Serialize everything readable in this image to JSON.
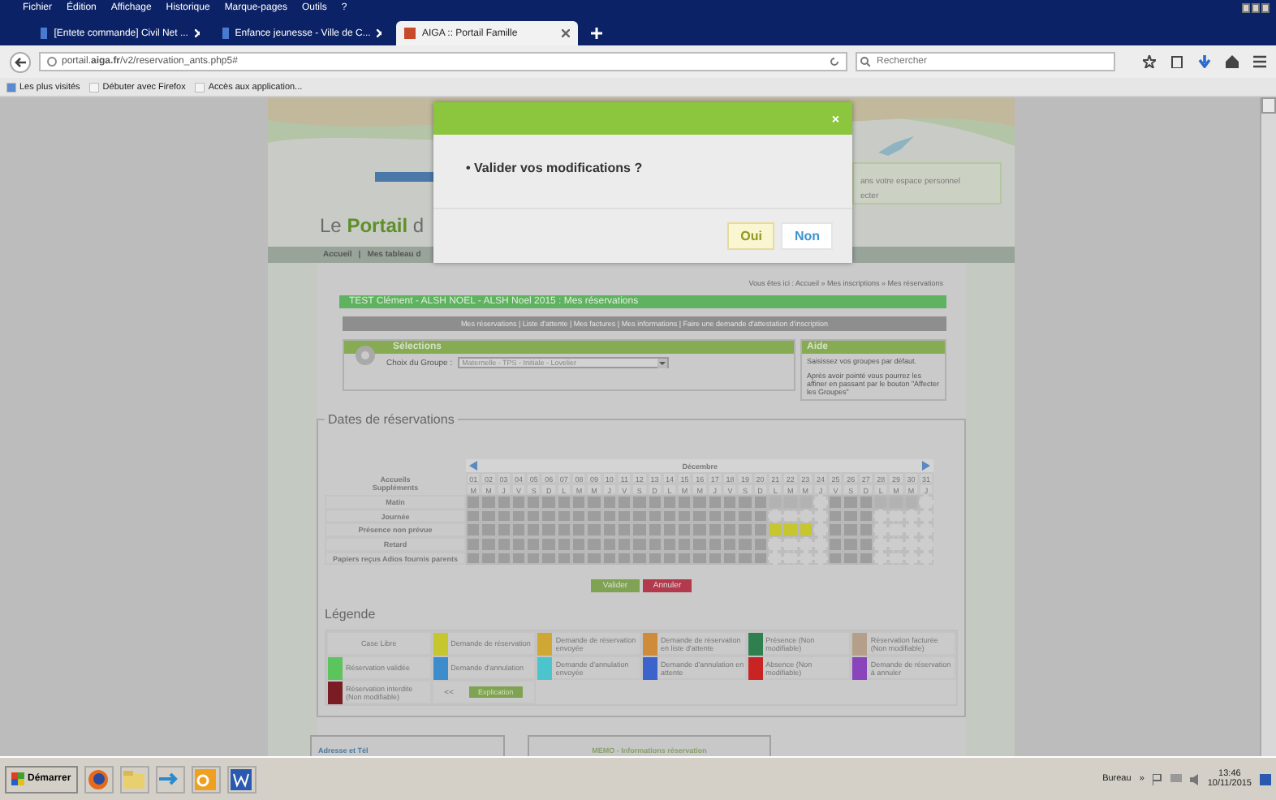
{
  "browser": {
    "menu": [
      "Fichier",
      "Édition",
      "Affichage",
      "Historique",
      "Marque-pages",
      "Outils",
      "?"
    ],
    "tabs": [
      {
        "title": "[Entete commande] Civil Net ...",
        "selected": false
      },
      {
        "title": "Enfance jeunesse - Ville de C...",
        "selected": false
      },
      {
        "title": "AIGA :: Portail Famille",
        "selected": true
      }
    ],
    "address": "portail.**aiga.fr**/v2/reservation_ants.php5#",
    "search": {
      "placeholder": "Rechercher"
    },
    "bookmarks": [
      "Les plus visités",
      "Débuter avec Firefox",
      "Accès aux application..."
    ]
  },
  "page": {
    "header": {
      "logo": "Le **Portail** d",
      "account_lines": [
        "ans votre espace personnel",
        "ecter"
      ]
    },
    "nav": [
      "Accueil",
      "|",
      "Mes tableau d"
    ],
    "breadcrumb": "Vous êtes ici : Accueil » Mes inscriptions » Mes réservations",
    "title": "TEST Clément - ALSH NOEL - ALSH Noel 2015 : Mes réservations",
    "subnav": "Mes réservations | Liste d'attente | Mes factures | Mes informations | Faire une demande d'attestation d'inscription",
    "selections": {
      "title": "Sélections",
      "group_label": "Choix du Groupe :",
      "group_value": "Maternelle - TPS - Initiale - Lovelier"
    },
    "help": {
      "title": "Aide",
      "paragraphs": [
        "Saisissez vos groupes par défaut.",
        "Après avoir pointé vous pourrez les affiner en passant par le bouton \"Affecter les Groupes\""
      ]
    },
    "reservations": {
      "legend": "Dates de réservations",
      "month": "Décembre",
      "header_labels": [
        "Accueils",
        "Suppléments"
      ],
      "days": [
        {
          "num": "01",
          "letter": "M"
        },
        {
          "num": "02",
          "letter": "M"
        },
        {
          "num": "03",
          "letter": "J"
        },
        {
          "num": "04",
          "letter": "V"
        },
        {
          "num": "05",
          "letter": "S"
        },
        {
          "num": "06",
          "letter": "D"
        },
        {
          "num": "07",
          "letter": "L"
        },
        {
          "num": "08",
          "letter": "M"
        },
        {
          "num": "09",
          "letter": "M"
        },
        {
          "num": "10",
          "letter": "J"
        },
        {
          "num": "11",
          "letter": "V"
        },
        {
          "num": "12",
          "letter": "S"
        },
        {
          "num": "13",
          "letter": "D"
        },
        {
          "num": "14",
          "letter": "L"
        },
        {
          "num": "15",
          "letter": "M"
        },
        {
          "num": "16",
          "letter": "M"
        },
        {
          "num": "17",
          "letter": "J"
        },
        {
          "num": "18",
          "letter": "V"
        },
        {
          "num": "19",
          "letter": "S"
        },
        {
          "num": "20",
          "letter": "D"
        },
        {
          "num": "21",
          "letter": "L"
        },
        {
          "num": "22",
          "letter": "M"
        },
        {
          "num": "23",
          "letter": "M"
        },
        {
          "num": "24",
          "letter": "J"
        },
        {
          "num": "25",
          "letter": "V"
        },
        {
          "num": "26",
          "letter": "S"
        },
        {
          "num": "27",
          "letter": "D"
        },
        {
          "num": "28",
          "letter": "L"
        },
        {
          "num": "29",
          "letter": "M"
        },
        {
          "num": "30",
          "letter": "M"
        },
        {
          "num": "31",
          "letter": "J"
        }
      ],
      "rows": [
        {
          "label": "Matin",
          "cells": [
            {
              "kind": "closed"
            },
            {
              "kind": "closed"
            },
            {
              "kind": "closed"
            },
            {
              "kind": "closed"
            },
            {
              "kind": "closed"
            },
            {
              "kind": "closed"
            },
            {
              "kind": "closed"
            },
            {
              "kind": "closed"
            },
            {
              "kind": "closed"
            },
            {
              "kind": "closed"
            },
            {
              "kind": "closed"
            },
            {
              "kind": "closed"
            },
            {
              "kind": "closed"
            },
            {
              "kind": "closed"
            },
            {
              "kind": "closed"
            },
            {
              "kind": "closed"
            },
            {
              "kind": "closed"
            },
            {
              "kind": "closed"
            },
            {
              "kind": "closed"
            },
            {
              "kind": "closed"
            },
            {
              "kind": "unavailable"
            },
            {
              "kind": "unavailable"
            },
            {
              "kind": "unavailable"
            },
            {
              "kind": "free"
            },
            {
              "kind": "closed"
            },
            {
              "kind": "closed"
            },
            {
              "kind": "closed"
            },
            {
              "kind": "unavailable"
            },
            {
              "kind": "unavailable"
            },
            {
              "kind": "unavailable"
            },
            {
              "kind": "free"
            }
          ]
        },
        {
          "label": "Journée",
          "cells": [
            {
              "kind": "closed"
            },
            {
              "kind": "closed"
            },
            {
              "kind": "closed"
            },
            {
              "kind": "closed"
            },
            {
              "kind": "closed"
            },
            {
              "kind": "closed"
            },
            {
              "kind": "closed"
            },
            {
              "kind": "closed"
            },
            {
              "kind": "closed"
            },
            {
              "kind": "closed"
            },
            {
              "kind": "closed"
            },
            {
              "kind": "closed"
            },
            {
              "kind": "closed"
            },
            {
              "kind": "closed"
            },
            {
              "kind": "closed"
            },
            {
              "kind": "closed"
            },
            {
              "kind": "closed"
            },
            {
              "kind": "closed"
            },
            {
              "kind": "closed"
            },
            {
              "kind": "closed"
            },
            {
              "kind": "free"
            },
            {
              "kind": "free"
            },
            {
              "kind": "free"
            },
            {
              "kind": "free"
            },
            {
              "kind": "closed"
            },
            {
              "kind": "closed"
            },
            {
              "kind": "closed"
            },
            {
              "kind": "free"
            },
            {
              "kind": "free"
            },
            {
              "kind": "free"
            },
            {
              "kind": "free"
            }
          ]
        },
        {
          "label": "Présence non prévue",
          "cells": [
            {
              "kind": "closed"
            },
            {
              "kind": "closed"
            },
            {
              "kind": "closed"
            },
            {
              "kind": "closed"
            },
            {
              "kind": "closed"
            },
            {
              "kind": "closed"
            },
            {
              "kind": "closed"
            },
            {
              "kind": "closed"
            },
            {
              "kind": "closed"
            },
            {
              "kind": "closed"
            },
            {
              "kind": "closed"
            },
            {
              "kind": "closed"
            },
            {
              "kind": "closed"
            },
            {
              "kind": "closed"
            },
            {
              "kind": "closed"
            },
            {
              "kind": "closed"
            },
            {
              "kind": "closed"
            },
            {
              "kind": "closed"
            },
            {
              "kind": "closed"
            },
            {
              "kind": "closed"
            },
            {
              "kind": "requested"
            },
            {
              "kind": "requested"
            },
            {
              "kind": "requested"
            },
            {
              "kind": "free"
            },
            {
              "kind": "closed"
            },
            {
              "kind": "closed"
            },
            {
              "kind": "closed"
            },
            {
              "kind": "free"
            },
            {
              "kind": "free"
            },
            {
              "kind": "free"
            },
            {
              "kind": "free"
            }
          ]
        },
        {
          "label": "Retard",
          "cells": [
            {
              "kind": "closed"
            },
            {
              "kind": "closed"
            },
            {
              "kind": "closed"
            },
            {
              "kind": "closed"
            },
            {
              "kind": "closed"
            },
            {
              "kind": "closed"
            },
            {
              "kind": "closed"
            },
            {
              "kind": "closed"
            },
            {
              "kind": "closed"
            },
            {
              "kind": "closed"
            },
            {
              "kind": "closed"
            },
            {
              "kind": "closed"
            },
            {
              "kind": "closed"
            },
            {
              "kind": "closed"
            },
            {
              "kind": "closed"
            },
            {
              "kind": "closed"
            },
            {
              "kind": "closed"
            },
            {
              "kind": "closed"
            },
            {
              "kind": "closed"
            },
            {
              "kind": "closed"
            },
            {
              "kind": "free"
            },
            {
              "kind": "free"
            },
            {
              "kind": "free"
            },
            {
              "kind": "free"
            },
            {
              "kind": "closed"
            },
            {
              "kind": "closed"
            },
            {
              "kind": "closed"
            },
            {
              "kind": "free"
            },
            {
              "kind": "free"
            },
            {
              "kind": "free"
            },
            {
              "kind": "free"
            }
          ]
        },
        {
          "label": "Papiers reçus Adios fournis parents",
          "cells": [
            {
              "kind": "closed"
            },
            {
              "kind": "closed"
            },
            {
              "kind": "closed"
            },
            {
              "kind": "closed"
            },
            {
              "kind": "closed"
            },
            {
              "kind": "closed"
            },
            {
              "kind": "closed"
            },
            {
              "kind": "closed"
            },
            {
              "kind": "closed"
            },
            {
              "kind": "closed"
            },
            {
              "kind": "closed"
            },
            {
              "kind": "closed"
            },
            {
              "kind": "closed"
            },
            {
              "kind": "closed"
            },
            {
              "kind": "closed"
            },
            {
              "kind": "closed"
            },
            {
              "kind": "closed"
            },
            {
              "kind": "closed"
            },
            {
              "kind": "closed"
            },
            {
              "kind": "closed"
            },
            {
              "kind": "free"
            },
            {
              "kind": "free"
            },
            {
              "kind": "free"
            },
            {
              "kind": "free"
            },
            {
              "kind": "closed"
            },
            {
              "kind": "closed"
            },
            {
              "kind": "closed"
            },
            {
              "kind": "free"
            },
            {
              "kind": "free"
            },
            {
              "kind": "free"
            },
            {
              "kind": "free"
            }
          ]
        }
      ],
      "buttons": [
        {
          "label": "Valider",
          "kind": "confirm"
        },
        {
          "label": "Annuler",
          "kind": "cancel"
        }
      ]
    },
    "legend": {
      "title": "Légende",
      "items": [
        {
          "label": "Case Libre"
        },
        {
          "label": "Demande de réservation",
          "color": "#c6c62e"
        },
        {
          "label": "Demande de réservation envoyée",
          "color": "#cfa734"
        },
        {
          "label": "Demande de réservation en liste d'attente",
          "color": "#cf8a3a"
        },
        {
          "label": "Présence (Non modifiable)",
          "color": "#2f7f4f"
        },
        {
          "label": "Réservation facturée (Non modifiable)",
          "color": "#b4a08a"
        },
        {
          "label": "Réservation validée",
          "color": "#5cc45c"
        },
        {
          "label": "Demande d'annulation",
          "color": "#3d8ccc"
        },
        {
          "label": "Demande d'annulation envoyée",
          "color": "#4cc4cc"
        },
        {
          "label": "Demande d'annulation en attente",
          "color": "#3c62cc"
        },
        {
          "label": "Absence (Non modifiable)",
          "color": "#c82424"
        },
        {
          "label": "Demande de réservation à annuler",
          "color": "#8a44bc"
        },
        {
          "label": "Réservation interdite (Non modifiable)",
          "color": "#7a1c24"
        }
      ],
      "toggle": "<<",
      "explain": "Explication"
    },
    "bottom": [
      "Adresse et Tél",
      "MEMO - Informations réservation"
    ]
  },
  "modal": {
    "close": "×",
    "message": "• Valider vos modifications ?",
    "buttons": [
      {
        "label": "Oui",
        "focused": true
      },
      {
        "label": "Non",
        "focused": false
      }
    ]
  },
  "taskbar": {
    "start": "Démarrer",
    "toolbar": "Bureau",
    "chevron": "»",
    "time": "13:46",
    "date": "10/11/2015"
  }
}
